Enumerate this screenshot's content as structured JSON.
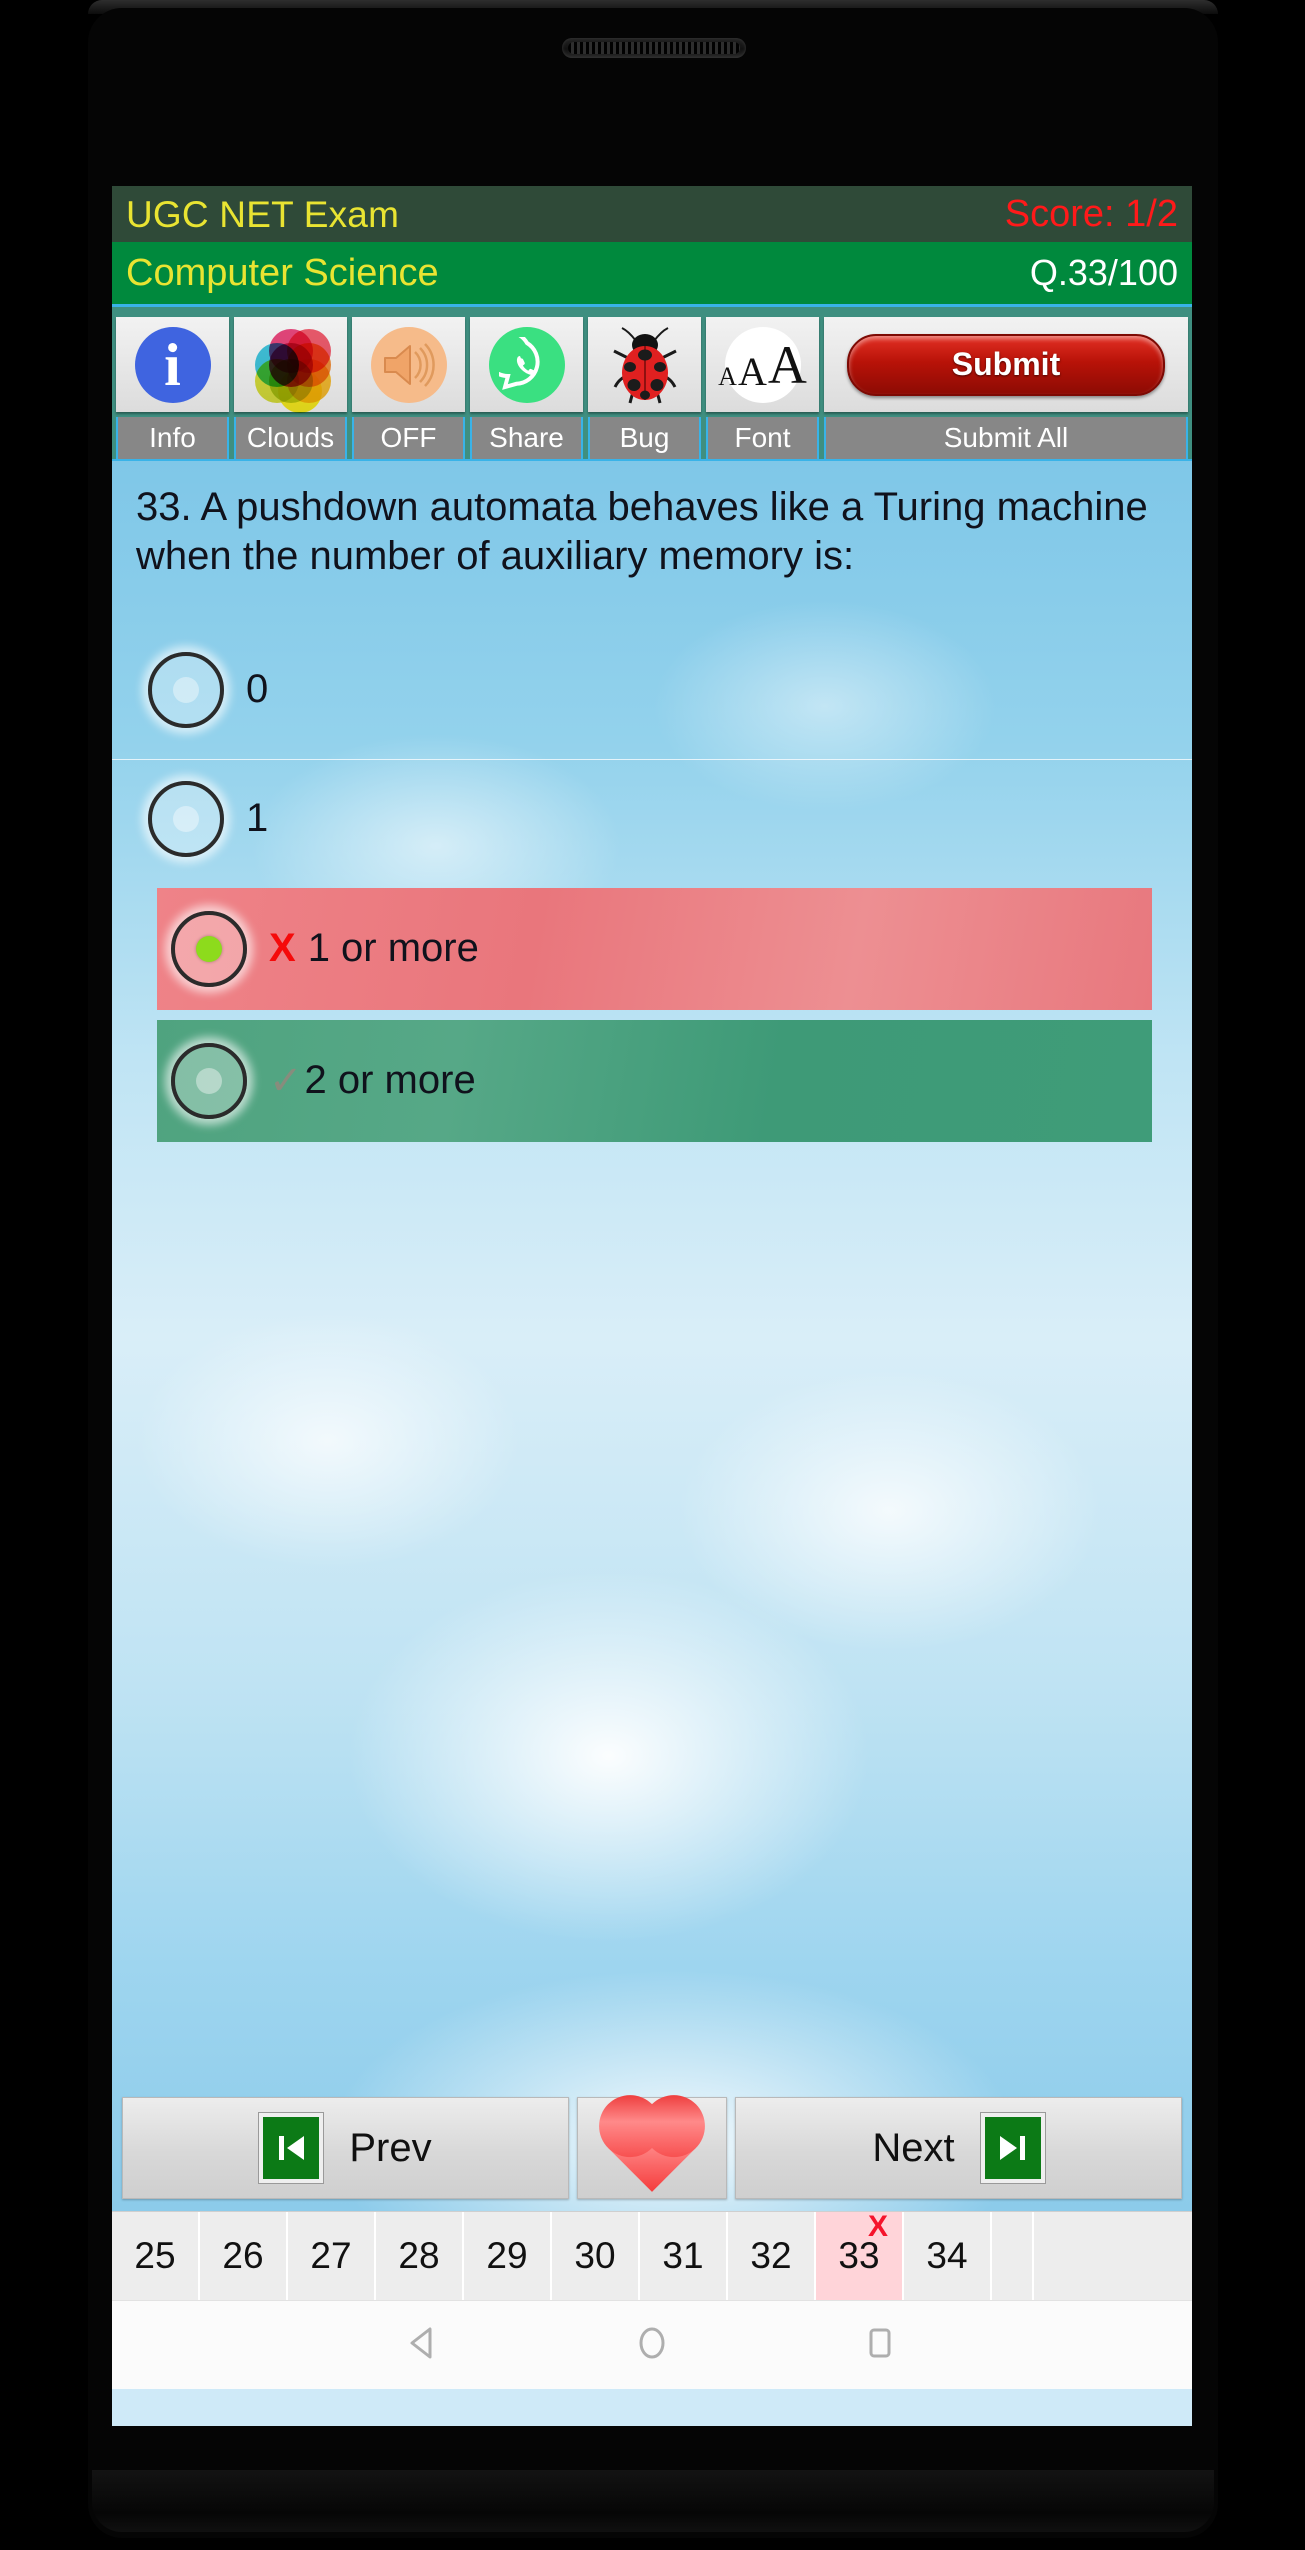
{
  "device": {
    "speaker_grille": "speaker-grille"
  },
  "header": {
    "app_title": "UGC NET Exam",
    "score_label": "Score: 1/2",
    "subject": "Computer Science",
    "question_counter": "Q.33/100"
  },
  "toolbar": {
    "items": [
      {
        "label": "Info",
        "icon": "info-icon"
      },
      {
        "label": "Clouds",
        "icon": "color-wheel-icon"
      },
      {
        "label": "OFF",
        "icon": "speaker-icon"
      },
      {
        "label": "Share",
        "icon": "whatsapp-share-icon"
      },
      {
        "label": "Bug",
        "icon": "ladybug-icon"
      },
      {
        "label": "Font",
        "icon": "font-size-icon"
      },
      {
        "label": "Submit All",
        "icon": "submit-button-icon"
      }
    ],
    "submit_button_label": "Submit"
  },
  "question": {
    "text": "33. A pushdown automata behaves like a Turing machine when the number of auxiliary memory is:",
    "options": [
      {
        "text": "0",
        "state": "none",
        "selected": false,
        "mark": ""
      },
      {
        "text": "1",
        "state": "none",
        "selected": false,
        "mark": ""
      },
      {
        "text": "1 or more",
        "state": "wrong",
        "selected": true,
        "mark": "X"
      },
      {
        "text": "2 or more",
        "state": "correct",
        "selected": false,
        "mark": "✓"
      }
    ]
  },
  "navigation": {
    "prev_label": "Prev",
    "next_label": "Next",
    "favorite_icon": "heart-icon",
    "prev_icon": "skip-previous-icon",
    "next_icon": "skip-next-icon"
  },
  "number_strip": {
    "numbers": [
      "25",
      "26",
      "27",
      "28",
      "29",
      "30",
      "31",
      "32",
      "33",
      "34",
      ""
    ],
    "current": "33",
    "current_mark": "X"
  },
  "android_nav": {
    "back": "back-triangle-icon",
    "home": "home-circle-icon",
    "recents": "recents-square-icon"
  },
  "colors": {
    "header_top_bg": "#2f4a38",
    "header_sub_bg": "#00893d",
    "title_yellow": "#e9e432",
    "score_red": "#ff1a1a",
    "toolbar_teal": "#3f8f80",
    "toolbar_accent": "#39b3e8",
    "wrong_red": "#e9767c",
    "correct_green": "#4fa37f",
    "radio_dot_green": "#8ddb1c",
    "current_cell_pink": "#ffd4d9"
  }
}
